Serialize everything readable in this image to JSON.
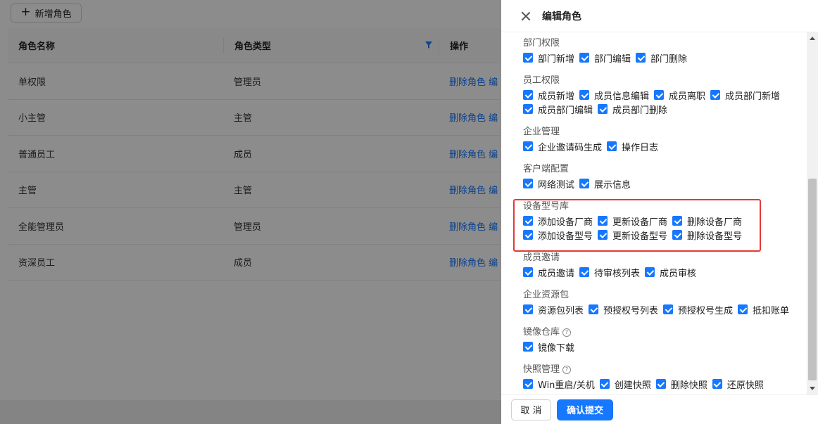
{
  "page": {
    "add_button_label": "新增角色",
    "columns": [
      "角色名称",
      "角色类型",
      "操作"
    ],
    "rows": [
      {
        "name": "单权限",
        "type": "管理员",
        "action": "删除角色 编"
      },
      {
        "name": "小主管",
        "type": "主管",
        "action": "删除角色 编"
      },
      {
        "name": "普通员工",
        "type": "成员",
        "action": "删除角色 编"
      },
      {
        "name": "主管",
        "type": "主管",
        "action": "删除角色 编"
      },
      {
        "name": "全能管理员",
        "type": "管理员",
        "action": "删除角色 编"
      },
      {
        "name": "资深员工",
        "type": "成员",
        "action": "删除角色 编"
      }
    ]
  },
  "drawer": {
    "title": "编辑角色",
    "groups": [
      {
        "title": "部门权限",
        "lines": [
          [
            "部门新增",
            "部门编辑",
            "部门删除"
          ]
        ]
      },
      {
        "title": "员工权限",
        "lines": [
          [
            "成员新增",
            "成员信息编辑",
            "成员离职",
            "成员部门新增"
          ],
          [
            "成员部门编辑",
            "成员部门删除"
          ]
        ]
      },
      {
        "title": "企业管理",
        "lines": [
          [
            "企业邀请码生成",
            "操作日志"
          ]
        ]
      },
      {
        "title": "客户端配置",
        "lines": [
          [
            "网络测试",
            "展示信息"
          ]
        ]
      },
      {
        "title": "设备型号库",
        "lines": [
          [
            "添加设备厂商",
            "更新设备厂商",
            "删除设备厂商"
          ],
          [
            "添加设备型号",
            "更新设备型号",
            "删除设备型号"
          ]
        ]
      },
      {
        "title": "成员邀请",
        "lines": [
          [
            "成员邀请",
            "待审核列表",
            "成员审核"
          ]
        ]
      },
      {
        "title": "企业资源包",
        "lines": [
          [
            "资源包列表",
            "预授权号列表",
            "预授权号生成",
            "抵扣账单"
          ]
        ]
      },
      {
        "title": "镜像仓库",
        "help": true,
        "lines": [
          [
            "镜像下载"
          ]
        ]
      },
      {
        "title": "快照管理",
        "help": true,
        "lines": [
          [
            "Win重启/关机",
            "创建快照",
            "删除快照",
            "还原快照"
          ]
        ]
      }
    ],
    "cancel_label": "取 消",
    "submit_label": "确认提交"
  },
  "colors": {
    "primary": "#1677ff",
    "highlight": "#e53935"
  }
}
